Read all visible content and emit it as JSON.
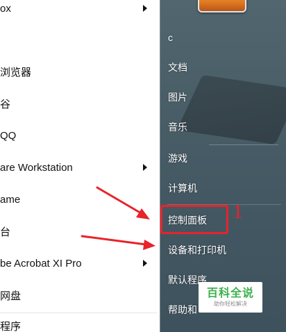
{
  "start_menu": {
    "programs": [
      {
        "label": "ox",
        "has_submenu": true
      },
      {
        "label": "",
        "has_submenu": false
      },
      {
        "label": "浏览器",
        "has_submenu": false
      },
      {
        "label": "谷",
        "has_submenu": false
      },
      {
        "label": "QQ",
        "has_submenu": false
      },
      {
        "label": "are Workstation",
        "has_submenu": true
      },
      {
        "label": "ame",
        "has_submenu": false
      },
      {
        "label": "台",
        "has_submenu": false
      },
      {
        "label": "be Acrobat XI Pro",
        "has_submenu": true
      },
      {
        "label": "网盘",
        "has_submenu": false
      },
      {
        "label": "程序",
        "has_submenu": false
      }
    ],
    "links": [
      {
        "label": "c"
      },
      {
        "label": "文档"
      },
      {
        "label": "图片"
      },
      {
        "label": "音乐"
      },
      {
        "label": "游戏"
      },
      {
        "label": "计算机"
      },
      {
        "label": "控制面板"
      },
      {
        "label": "设备和打印机"
      },
      {
        "label": "默认程序"
      },
      {
        "label": "帮助和"
      }
    ]
  },
  "annotation": {
    "step_number": "1",
    "color": "#e8232a"
  },
  "watermark": {
    "title": "百科全说",
    "subtitle": "助你轻松解决"
  }
}
